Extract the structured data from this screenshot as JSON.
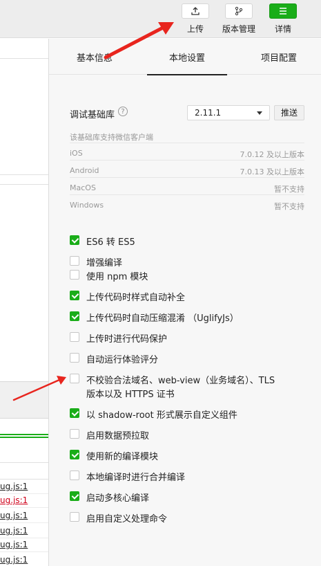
{
  "toolbar": {
    "upload_label": "上传",
    "version_label": "版本管理",
    "details_label": "详情"
  },
  "tabs": [
    {
      "label": "基本信息"
    },
    {
      "label": "本地设置"
    },
    {
      "label": "项目配置"
    }
  ],
  "debug_lib": {
    "label": "调试基础库",
    "help": "?",
    "version": "2.11.1",
    "push_label": "推送",
    "support_note": "该基础库支持微信客户端",
    "platforms": [
      {
        "name": "iOS",
        "value": "7.0.12 及以上版本"
      },
      {
        "name": "Android",
        "value": "7.0.13 及以上版本"
      },
      {
        "name": "MacOS",
        "value": "暂不支持"
      },
      {
        "name": "Windows",
        "value": "暂不支持"
      }
    ]
  },
  "options": [
    {
      "label": "ES6 转 ES5",
      "checked": true
    },
    {
      "label": "增强编译",
      "checked": false
    },
    {
      "label": "使用 npm 模块",
      "checked": false
    },
    {
      "label": "上传代码时样式自动补全",
      "checked": true
    },
    {
      "label": "上传代码时自动压缩混淆 （UglifyJs）",
      "checked": true
    },
    {
      "label": "上传时进行代码保护",
      "checked": false
    },
    {
      "label": "自动运行体验评分",
      "checked": false
    },
    {
      "label": "不校验合法域名、web-view（业务域名）、TLS",
      "label2": "版本以及 HTTPS 证书",
      "checked": false
    },
    {
      "label": "以 shadow-root 形式展示自定义组件",
      "checked": true
    },
    {
      "label": "启用数据预拉取",
      "checked": false
    },
    {
      "label": "使用新的编译模块",
      "checked": true
    },
    {
      "label": "本地编译时进行合并编译",
      "checked": false
    },
    {
      "label": "启动多核心编译",
      "checked": true
    },
    {
      "label": "启用自定义处理命令",
      "checked": false
    }
  ],
  "left_panel": {
    "links": [
      "ug.js:1",
      "ug.js:1",
      "ug.js:1",
      "ug.js:1",
      "ug.js:1",
      "ug.js:1"
    ],
    "link_colors": [
      "#222222",
      "#d0021b",
      "#222222",
      "#222222",
      "#222222",
      "#222222"
    ]
  },
  "colors": {
    "accent_green": "#1aad19",
    "annotation_red": "#e8251e"
  }
}
